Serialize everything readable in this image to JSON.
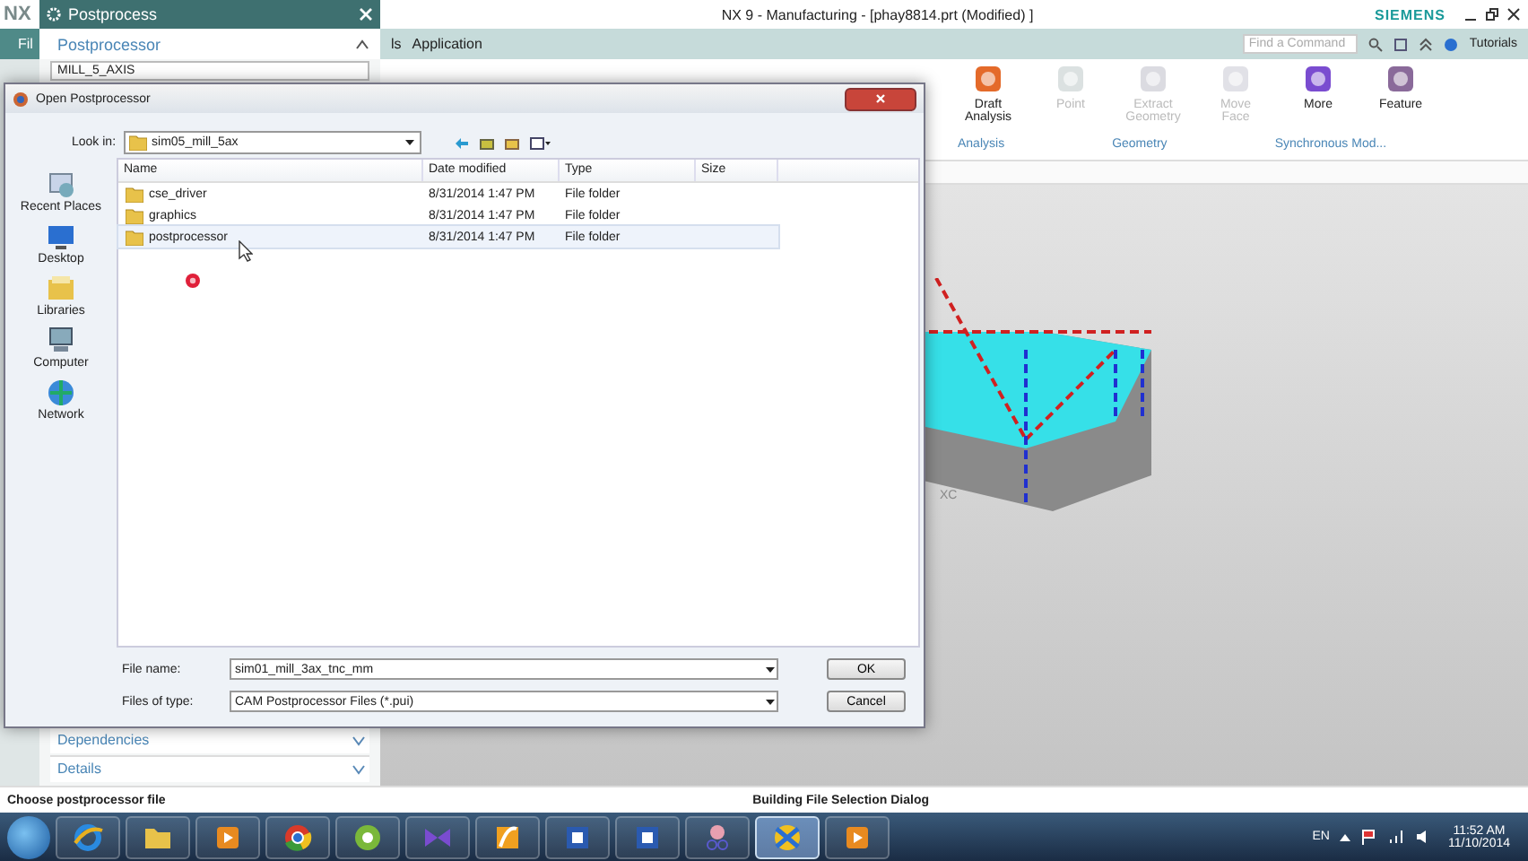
{
  "window": {
    "logo": "NX",
    "title": "NX 9 - Manufacturing - [phay8814.prt (Modified) ]",
    "brand": "SIEMENS"
  },
  "menu": {
    "items": [
      {
        "label": "Fil"
      },
      {
        "label": "ls"
      },
      {
        "label": "Application"
      }
    ]
  },
  "command_search": {
    "placeholder": "Find a Command"
  },
  "help_link": "Tutorials",
  "ribbon": {
    "buttons": [
      {
        "label": "Draft Analysis",
        "disabled": false
      },
      {
        "label": "Point",
        "disabled": true
      },
      {
        "label": "Extract Geometry",
        "disabled": true
      },
      {
        "label": "Move Face",
        "disabled": true
      },
      {
        "label": "More",
        "disabled": false
      },
      {
        "label": "Feature",
        "disabled": false
      }
    ],
    "groups": [
      "Analysis",
      "Geometry",
      "Synchronous Mod..."
    ]
  },
  "viewport": {
    "axis_label": "XC"
  },
  "postprocess_panel": {
    "title": "Postprocess",
    "section": "Postprocessor",
    "postprocessor": "MILL_5_AXIS",
    "sections": [
      {
        "label": "Dependencies",
        "expanded": false
      },
      {
        "label": "Details",
        "expanded": false
      }
    ]
  },
  "open_dialog": {
    "title": "Open Postprocessor",
    "look_in_label": "Look in:",
    "look_in": "sim05_mill_5ax",
    "places": [
      {
        "kind": "recent",
        "label": "Recent Places"
      },
      {
        "kind": "desktop",
        "label": "Desktop"
      },
      {
        "kind": "libraries",
        "label": "Libraries"
      },
      {
        "kind": "computer",
        "label": "Computer"
      },
      {
        "kind": "network",
        "label": "Network"
      }
    ],
    "columns": [
      "Name",
      "Date modified",
      "Type",
      "Size"
    ],
    "rows": [
      {
        "name": "cse_driver",
        "date": "8/31/2014 1:47 PM",
        "type": "File folder",
        "highlighted": false
      },
      {
        "name": "graphics",
        "date": "8/31/2014 1:47 PM",
        "type": "File folder",
        "highlighted": false
      },
      {
        "name": "postprocessor",
        "date": "8/31/2014 1:47 PM",
        "type": "File folder",
        "highlighted": true
      }
    ],
    "file_name_label": "File name:",
    "file_name": "sim01_mill_3ax_tnc_mm",
    "file_type_label": "Files of type:",
    "file_type": "CAM Postprocessor Files (*.pui)",
    "buttons": [
      "OK",
      "Cancel"
    ]
  },
  "status_bar": {
    "message": "Choose postprocessor file",
    "progress": "Building File Selection Dialog"
  },
  "taskbar": {
    "apps": [
      {
        "kind": "browser",
        "active": false
      },
      {
        "kind": "folder",
        "active": false
      },
      {
        "kind": "media",
        "active": false
      },
      {
        "kind": "chrome",
        "active": false
      },
      {
        "kind": "swirl",
        "active": false
      },
      {
        "kind": "bowtie",
        "active": false
      },
      {
        "kind": "flame",
        "active": false
      },
      {
        "kind": "document",
        "active": false
      },
      {
        "kind": "document",
        "active": false
      },
      {
        "kind": "scissors",
        "active": false
      },
      {
        "kind": "nx",
        "active": true
      },
      {
        "kind": "media",
        "active": false
      }
    ],
    "language": "EN",
    "time": "11:52 AM",
    "date": "11/10/2014"
  }
}
